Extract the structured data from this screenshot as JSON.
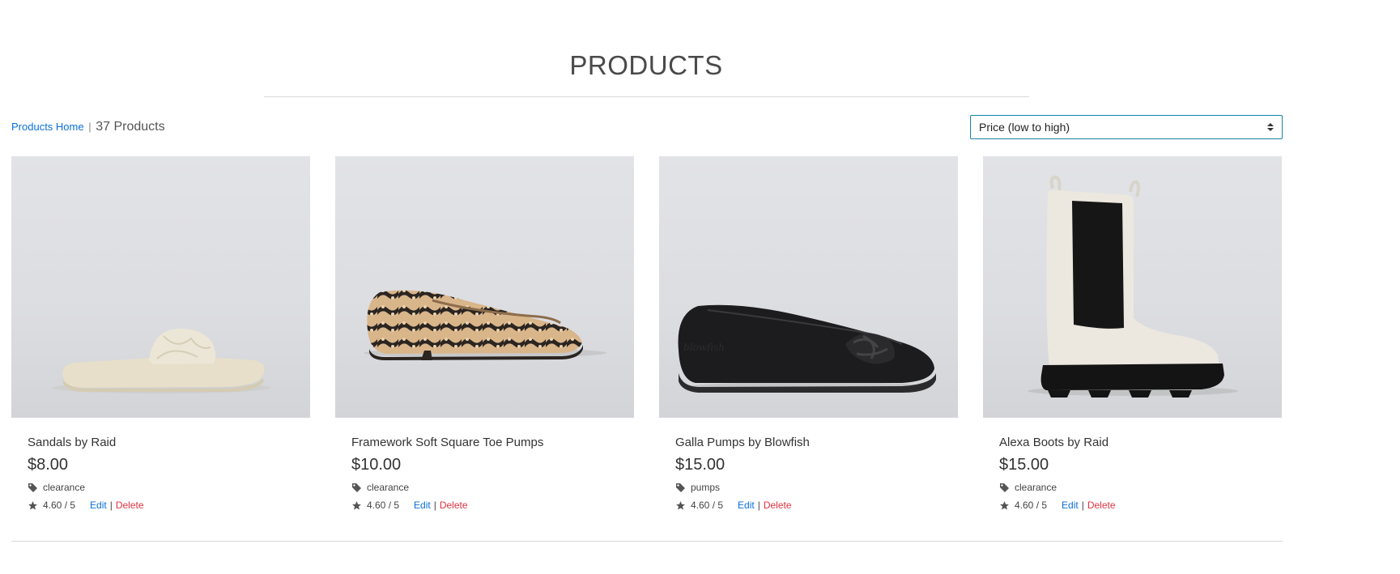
{
  "page": {
    "title": "PRODUCTS"
  },
  "toolbar": {
    "home_link": "Products Home",
    "separator": "|",
    "count": "37 Products",
    "sort_value": "Price (low to high)"
  },
  "products": [
    {
      "name": "Sandals by Raid",
      "price": "$8.00",
      "tag": "clearance",
      "rating": "4.60 / 5",
      "edit_label": "Edit",
      "delete_label": "Delete",
      "image_icon": "sandal-image"
    },
    {
      "name": "Framework Soft Square Toe Pumps",
      "price": "$10.00",
      "tag": "clearance",
      "rating": "4.60 / 5",
      "edit_label": "Edit",
      "delete_label": "Delete",
      "image_icon": "snakeskin-pump-image"
    },
    {
      "name": "Galla Pumps by Blowfish",
      "price": "$15.00",
      "tag": "pumps",
      "rating": "4.60 / 5",
      "edit_label": "Edit",
      "delete_label": "Delete",
      "image_icon": "black-pump-image"
    },
    {
      "name": "Alexa Boots by Raid",
      "price": "$15.00",
      "tag": "clearance",
      "rating": "4.60 / 5",
      "edit_label": "Edit",
      "delete_label": "Delete",
      "image_icon": "chelsea-boot-image"
    }
  ],
  "colors": {
    "link": "#0a6fd8",
    "delete": "#e0323f",
    "select_border": "#1784a4"
  }
}
